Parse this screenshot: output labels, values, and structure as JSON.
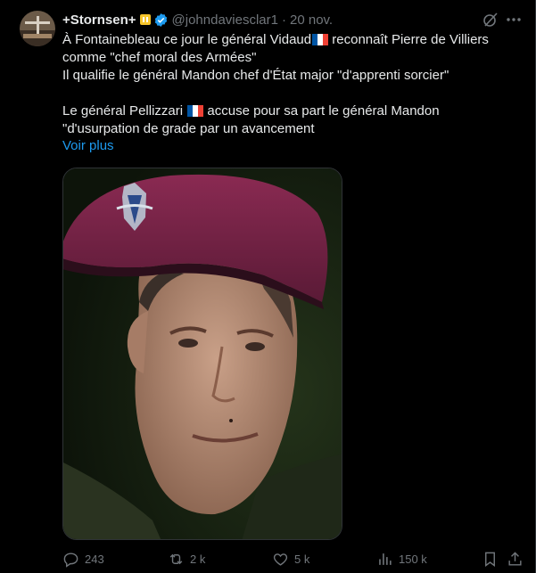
{
  "author": {
    "name": "+Stornsen+",
    "handle": "@johndaviesclar1",
    "separator": "·",
    "date": "20 nov."
  },
  "post": {
    "line1a": "À Fontainebleau ce jour le général Vidaud",
    "line1b": " reconnaît Pierre de Villiers",
    "line2": "comme \"chef moral des Armées\"",
    "line3": "Il qualifie le général Mandon chef d'État major \"d'apprenti sorcier\"",
    "line4a": "Le général Pellizzari ",
    "line4b": " accuse pour sa part le général Mandon",
    "line5": "\"d'usurpation de grade par un avancement",
    "show_more": "Voir plus"
  },
  "actions": {
    "replies": "243",
    "reposts": "2 k",
    "likes": "5 k",
    "views": "150 k"
  },
  "colors": {
    "background": "#000000",
    "text": "#e7e9ea",
    "muted": "#71767b",
    "link": "#1d9bf0",
    "beret": "#7a2347"
  }
}
